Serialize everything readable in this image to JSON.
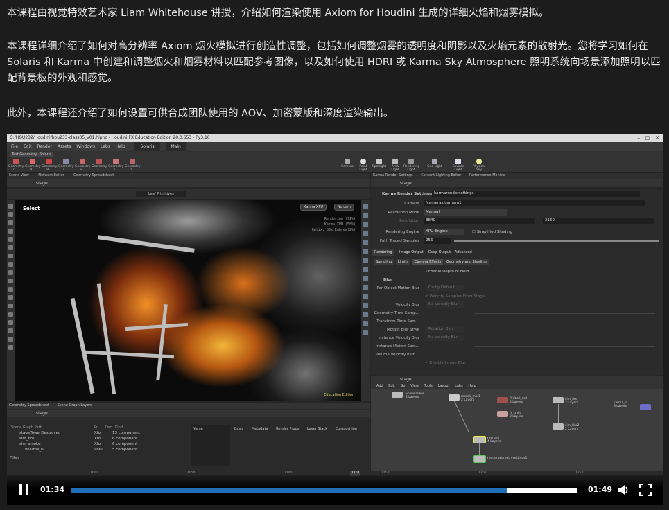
{
  "description": {
    "p1": "本课程由视觉特效艺术家 Liam Whitehouse 讲授，介绍如何渲染使用 Axiom for Houdini 生成的详细火焰和烟雾模拟。",
    "p2": "本课程详细介绍了如何对高分辨率 Axiom 烟火模拟进行创造性调整，包括如何调整烟雾的透明度和阴影以及火焰元素的散射光。您将学习如何在 Solaris 和 Karma 中创建和调整烟火和烟雾材料以匹配参考图像，以及如何使用 HDRI 或 Karma Sky Atmosphere 照明系统向场景添加照明以匹配背景板的外观和感觉。",
    "p3": "此外，本课程还介绍了如何设置可供合成团队使用的 AOV、加密蒙版和深度渲染输出。"
  },
  "houdini": {
    "window_title": "G:/HOU232/Houdini/hou233-class05_v01.hipnc - Houdini FX Education Edition 20.0.653 - Py3.10",
    "menu": [
      "File",
      "Edit",
      "Render",
      "Assets",
      "Windows",
      "Labs",
      "Help"
    ],
    "desktop": "Solaris",
    "main_label": "Main",
    "shelf_tabs": [
      "Test Geometry",
      "Solaris"
    ],
    "shelf_tools": [
      "Geometry C...",
      "Geometry B...",
      "Geometry B...",
      "Geometry C...",
      "Geometry S...",
      "Geometry T...",
      "Geometry T...",
      "Geometry T..."
    ],
    "light_tools": [
      "Camera",
      "Point Light",
      "Spotlight",
      "Area Light",
      "Rendering Light",
      "Geo Light",
      "Environ Light",
      "Physical Sky"
    ],
    "pane_tabs_left": [
      "Scene View",
      "Network Editor",
      "Geometry Spreadsheet"
    ],
    "pane_tabs_right": [
      "Karma Render Settings",
      "Content Lighting Editor",
      "Performance Monitor"
    ],
    "stage_path": "stage",
    "viewport": {
      "tool_label": "Select",
      "renderer": "Karma XPU",
      "camera": "No cam",
      "prim_label": "Leaf Primitives",
      "overlay": [
        "Rendering (71%)",
        "Karma XPU (58%)",
        "Optix: 85% Embree(2%)"
      ],
      "edition": "Education Edition"
    },
    "props": {
      "node_type": "Karma Render Settings",
      "node_name": "karmarendersettings",
      "camera_label": "Camera",
      "camera_value": "/cameras/camera1",
      "res_mode_label": "Resolution Mode",
      "res_mode_value": "Manual",
      "res_label": "Resolution",
      "res_w": "3840",
      "res_h": "2160",
      "engine_label": "Rendering Engine",
      "engine_value": "XPU Engine",
      "simplified": "Simplified Shading",
      "samples_label": "Path Traced Samples",
      "samples_value": "256",
      "tabs": [
        "Rendering",
        "Image Output",
        "Deep Output",
        "Advanced"
      ],
      "subtabs": [
        "Sampling",
        "Limits",
        "Camera Effects",
        "Geometry and Shading"
      ],
      "dof_label": "Enable Depth of Field",
      "blur_label": "Blur",
      "blur_rows": [
        {
          "label": "Per-Object Motion Blur",
          "value": "On by Default"
        },
        {
          "label": "",
          "value": "Velocity Samples From Stage"
        },
        {
          "label": "Velocity Blur",
          "value": "No Velocity Blur"
        },
        {
          "label": "Geometry Time Samp...",
          "value": ""
        },
        {
          "label": "Transform Time Sam...",
          "value": ""
        },
        {
          "label": "Motion Blur Style",
          "value": "Rotation Blur"
        },
        {
          "label": "Instance Velocity Blur",
          "value": "No Velocity Blur"
        },
        {
          "label": "Instance Motion Sam...",
          "value": ""
        },
        {
          "label": "Volume Velocity Blur ...",
          "value": ""
        },
        {
          "label": "",
          "value": "Disable Image Blur"
        }
      ]
    },
    "network": {
      "menu": [
        "Add",
        "Edit",
        "Go",
        "View",
        "Tools",
        "Layout",
        "Labs",
        "Help"
      ],
      "nodes": [
        {
          "name": "SceneTower...",
          "sub": "2 Layers"
        },
        {
          "name": "merch_mat1",
          "sub": "2 Layers"
        },
        {
          "name": "fs_unlit",
          "sub": "2 Layers"
        },
        {
          "name": "fireball_mtl",
          "sub": "2 Layers"
        },
        {
          "name": "sim_fire",
          "sub": "2 Layers"
        },
        {
          "name": "sim_fire2",
          "sub": "2 Layers"
        },
        {
          "name": "karma_1",
          "sub": "3 Layers"
        },
        {
          "name": "merge1",
          "sub": "4 Layers"
        },
        {
          "name": "rendergeometrysettings1",
          "sub": ""
        }
      ]
    },
    "spreadsheet": {
      "tabs": [
        "Geometry Spreadsheet",
        "Scene Graph Layers"
      ],
      "columns": [
        "Scene Graph Path",
        "Pri",
        "Dsc",
        "Kind"
      ],
      "rows": [
        {
          "path": "stageTowerDestroyed",
          "pri": "Xfo",
          "kind": "13 component"
        },
        {
          "path": "sim_fire",
          "pri": "Xfo",
          "kind": "6 component"
        },
        {
          "path": "sim_smoke",
          "pri": "Xfo",
          "kind": "6 component"
        },
        {
          "path": "volume_0",
          "pri": "Volu",
          "kind": "5 component"
        }
      ],
      "side_tabs": [
        "Name",
        "Basic",
        "Metadata",
        "Render Props",
        "Layer Stack",
        "Composition"
      ],
      "filter": "Filter",
      "timeline": [
        "1001",
        "1050",
        "1100",
        "1150",
        "1200",
        "1250"
      ],
      "frame": "1107"
    }
  },
  "player": {
    "current_time": "01:34",
    "duration": "01:49",
    "progress": 0.862
  }
}
